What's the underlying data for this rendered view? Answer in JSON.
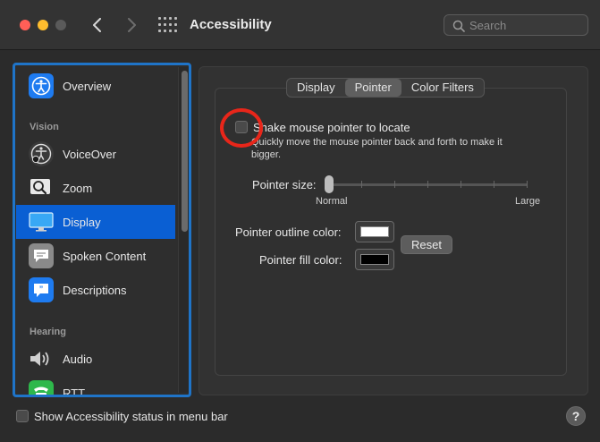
{
  "window": {
    "title": "Accessibility",
    "search_placeholder": "Search"
  },
  "sidebar": {
    "items": [
      {
        "label": "Overview",
        "icon": "accessibility-icon",
        "color": "#1e7bf0"
      },
      {
        "label": "VoiceOver",
        "icon": "voiceover-icon",
        "color": "#3a3a3a"
      },
      {
        "label": "Zoom",
        "icon": "zoom-icon",
        "color": "#3a3a3a"
      },
      {
        "label": "Display",
        "icon": "display-icon",
        "color": "#1f8ff0"
      },
      {
        "label": "Spoken Content",
        "icon": "speech-bubble-icon",
        "color": "#8a8a8a"
      },
      {
        "label": "Descriptions",
        "icon": "descriptions-icon",
        "color": "#1e7bf0"
      },
      {
        "label": "Audio",
        "icon": "speaker-icon",
        "color": "#bdbdbd"
      },
      {
        "label": "RTT",
        "icon": "rtt-icon",
        "color": "#2eb84b"
      }
    ],
    "sections": {
      "vision": "Vision",
      "hearing": "Hearing"
    },
    "selected": "Display"
  },
  "tabs": {
    "display": "Display",
    "pointer": "Pointer",
    "color_filters": "Color Filters",
    "selected": "Pointer"
  },
  "pointer": {
    "shake_label": "Shake mouse pointer to locate",
    "shake_desc": "Quickly move the mouse pointer back and forth to make it bigger.",
    "shake_checked": false,
    "size_label": "Pointer size:",
    "size_min": "Normal",
    "size_max": "Large",
    "size_value": 0,
    "outline_label": "Pointer outline color:",
    "outline_color": "#ffffff",
    "fill_label": "Pointer fill color:",
    "fill_color": "#000000",
    "reset_label": "Reset"
  },
  "footer": {
    "status_label": "Show Accessibility status in menu bar",
    "status_checked": false,
    "help": "?"
  }
}
